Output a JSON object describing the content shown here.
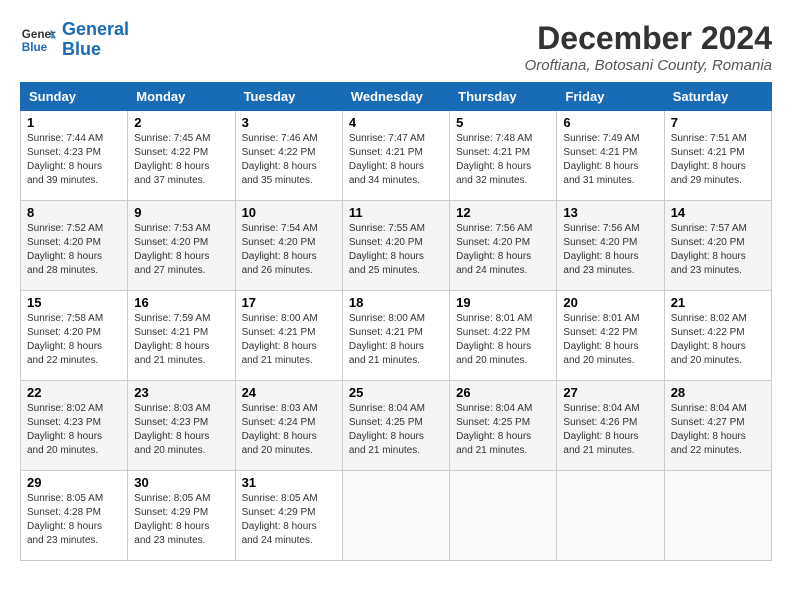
{
  "logo": {
    "text_general": "General",
    "text_blue": "Blue"
  },
  "header": {
    "title": "December 2024",
    "subtitle": "Oroftiana, Botosani County, Romania"
  },
  "weekdays": [
    "Sunday",
    "Monday",
    "Tuesday",
    "Wednesday",
    "Thursday",
    "Friday",
    "Saturday"
  ],
  "weeks": [
    [
      {
        "day": "1",
        "sunrise": "7:44 AM",
        "sunset": "4:23 PM",
        "daylight": "8 hours and 39 minutes."
      },
      {
        "day": "2",
        "sunrise": "7:45 AM",
        "sunset": "4:22 PM",
        "daylight": "8 hours and 37 minutes."
      },
      {
        "day": "3",
        "sunrise": "7:46 AM",
        "sunset": "4:22 PM",
        "daylight": "8 hours and 35 minutes."
      },
      {
        "day": "4",
        "sunrise": "7:47 AM",
        "sunset": "4:21 PM",
        "daylight": "8 hours and 34 minutes."
      },
      {
        "day": "5",
        "sunrise": "7:48 AM",
        "sunset": "4:21 PM",
        "daylight": "8 hours and 32 minutes."
      },
      {
        "day": "6",
        "sunrise": "7:49 AM",
        "sunset": "4:21 PM",
        "daylight": "8 hours and 31 minutes."
      },
      {
        "day": "7",
        "sunrise": "7:51 AM",
        "sunset": "4:21 PM",
        "daylight": "8 hours and 29 minutes."
      }
    ],
    [
      {
        "day": "8",
        "sunrise": "7:52 AM",
        "sunset": "4:20 PM",
        "daylight": "8 hours and 28 minutes."
      },
      {
        "day": "9",
        "sunrise": "7:53 AM",
        "sunset": "4:20 PM",
        "daylight": "8 hours and 27 minutes."
      },
      {
        "day": "10",
        "sunrise": "7:54 AM",
        "sunset": "4:20 PM",
        "daylight": "8 hours and 26 minutes."
      },
      {
        "day": "11",
        "sunrise": "7:55 AM",
        "sunset": "4:20 PM",
        "daylight": "8 hours and 25 minutes."
      },
      {
        "day": "12",
        "sunrise": "7:56 AM",
        "sunset": "4:20 PM",
        "daylight": "8 hours and 24 minutes."
      },
      {
        "day": "13",
        "sunrise": "7:56 AM",
        "sunset": "4:20 PM",
        "daylight": "8 hours and 23 minutes."
      },
      {
        "day": "14",
        "sunrise": "7:57 AM",
        "sunset": "4:20 PM",
        "daylight": "8 hours and 23 minutes."
      }
    ],
    [
      {
        "day": "15",
        "sunrise": "7:58 AM",
        "sunset": "4:20 PM",
        "daylight": "8 hours and 22 minutes."
      },
      {
        "day": "16",
        "sunrise": "7:59 AM",
        "sunset": "4:21 PM",
        "daylight": "8 hours and 21 minutes."
      },
      {
        "day": "17",
        "sunrise": "8:00 AM",
        "sunset": "4:21 PM",
        "daylight": "8 hours and 21 minutes."
      },
      {
        "day": "18",
        "sunrise": "8:00 AM",
        "sunset": "4:21 PM",
        "daylight": "8 hours and 21 minutes."
      },
      {
        "day": "19",
        "sunrise": "8:01 AM",
        "sunset": "4:22 PM",
        "daylight": "8 hours and 20 minutes."
      },
      {
        "day": "20",
        "sunrise": "8:01 AM",
        "sunset": "4:22 PM",
        "daylight": "8 hours and 20 minutes."
      },
      {
        "day": "21",
        "sunrise": "8:02 AM",
        "sunset": "4:22 PM",
        "daylight": "8 hours and 20 minutes."
      }
    ],
    [
      {
        "day": "22",
        "sunrise": "8:02 AM",
        "sunset": "4:23 PM",
        "daylight": "8 hours and 20 minutes."
      },
      {
        "day": "23",
        "sunrise": "8:03 AM",
        "sunset": "4:23 PM",
        "daylight": "8 hours and 20 minutes."
      },
      {
        "day": "24",
        "sunrise": "8:03 AM",
        "sunset": "4:24 PM",
        "daylight": "8 hours and 20 minutes."
      },
      {
        "day": "25",
        "sunrise": "8:04 AM",
        "sunset": "4:25 PM",
        "daylight": "8 hours and 21 minutes."
      },
      {
        "day": "26",
        "sunrise": "8:04 AM",
        "sunset": "4:25 PM",
        "daylight": "8 hours and 21 minutes."
      },
      {
        "day": "27",
        "sunrise": "8:04 AM",
        "sunset": "4:26 PM",
        "daylight": "8 hours and 21 minutes."
      },
      {
        "day": "28",
        "sunrise": "8:04 AM",
        "sunset": "4:27 PM",
        "daylight": "8 hours and 22 minutes."
      }
    ],
    [
      {
        "day": "29",
        "sunrise": "8:05 AM",
        "sunset": "4:28 PM",
        "daylight": "8 hours and 23 minutes."
      },
      {
        "day": "30",
        "sunrise": "8:05 AM",
        "sunset": "4:29 PM",
        "daylight": "8 hours and 23 minutes."
      },
      {
        "day": "31",
        "sunrise": "8:05 AM",
        "sunset": "4:29 PM",
        "daylight": "8 hours and 24 minutes."
      },
      null,
      null,
      null,
      null
    ]
  ]
}
